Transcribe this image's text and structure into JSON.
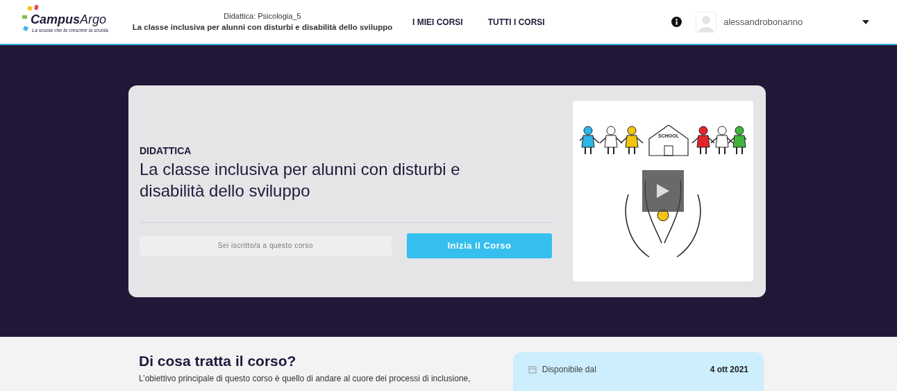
{
  "header": {
    "logo": {
      "name_bold": "Campus",
      "name_light": "Argo",
      "tagline": "La scuola che fa crescere la scuola."
    },
    "breadcrumb": "Didattica: Psicologia_5",
    "course_title": "La classe inclusiva per alunni con disturbi e disabilità dello sviluppo",
    "nav": [
      {
        "label": "I MIEI CORSI"
      },
      {
        "label": "TUTTI I CORSI"
      }
    ],
    "user": "alessandrobonanno"
  },
  "hero": {
    "category": "DIDATTICA",
    "title": "La classe inclusiva per alunni con disturbi e disabilità dello sviluppo",
    "status": "Sei iscritto/a a questo corso",
    "button": "Inizia il Corso",
    "video": {
      "sign": "SCHOOL"
    }
  },
  "about": {
    "heading": "Di cosa tratta il corso?",
    "text": "L’obiettivo principale di questo corso è quello di andare al cuore dei processi di inclusione,"
  },
  "info": [
    {
      "label": "Disponibile dal",
      "value": "4 ott 2021"
    }
  ]
}
